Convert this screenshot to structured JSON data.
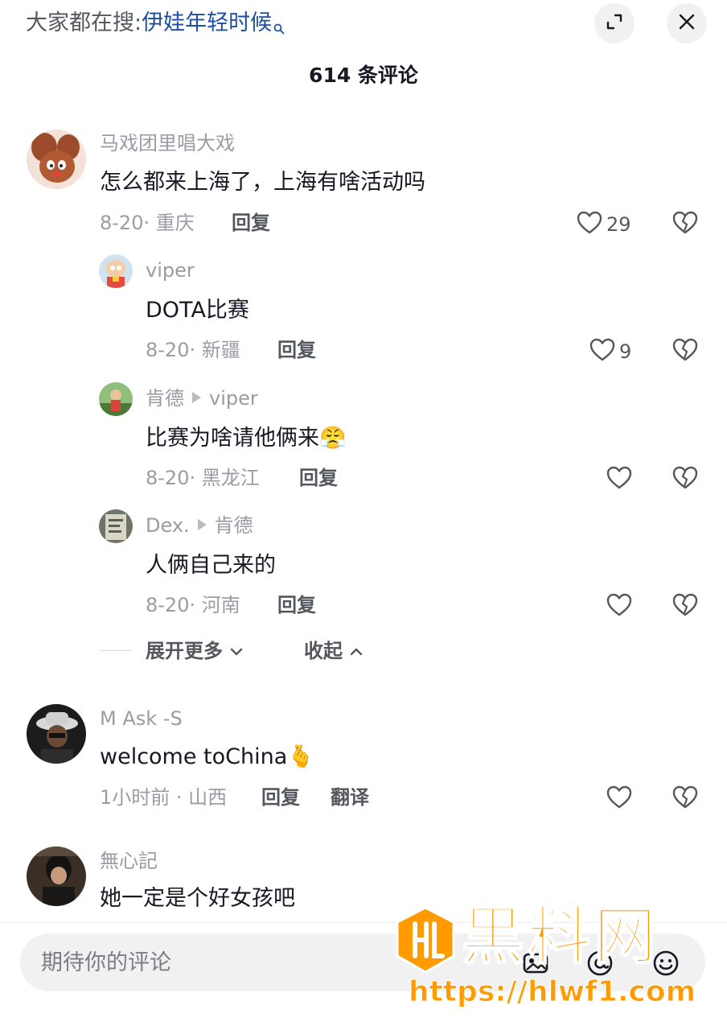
{
  "topbar": {
    "hint_prefix": "大家都在搜:",
    "hint_term": "伊娃年轻时候",
    "expand_icon": "expand-icon",
    "close_icon": "close-icon"
  },
  "comment_count": "614 条评论",
  "comments": [
    {
      "user": "马戏团里唱大戏",
      "text": "怎么都来上海了，上海有啥活动吗",
      "meta": "8-20· 重庆",
      "reply": "回复",
      "likes": "29"
    },
    {
      "user": "viper",
      "text": "DOTA比赛",
      "meta": "8-20· 新疆",
      "reply": "回复",
      "likes": "9"
    },
    {
      "user": "肯德",
      "reply_to": "viper",
      "text": "比赛为啥请他俩来",
      "emoji": "😤",
      "meta": "8-20· 黑龙江",
      "reply": "回复"
    },
    {
      "user": "Dex.",
      "reply_to": "肯德",
      "text": "人俩自己来的",
      "meta": "8-20· 河南",
      "reply": "回复"
    },
    {
      "user": "M Ask -S",
      "text": "welcome toChina",
      "emoji": "🫰",
      "meta": "1小时前 · 山西",
      "reply": "回复",
      "translate": "翻译"
    },
    {
      "user": "無心記",
      "text": "她一定是个好女孩吧"
    }
  ],
  "thread": {
    "expand_more": "展开更多",
    "collapse": "收起"
  },
  "input": {
    "placeholder": "期待你的评论"
  },
  "watermark": {
    "title": "黑料网",
    "url": "https://hlwf1.com"
  },
  "colors": {
    "accent_link": "#1f4f9e",
    "watermark": "#ff9a00",
    "secondary_text": "#9a9ca3"
  }
}
